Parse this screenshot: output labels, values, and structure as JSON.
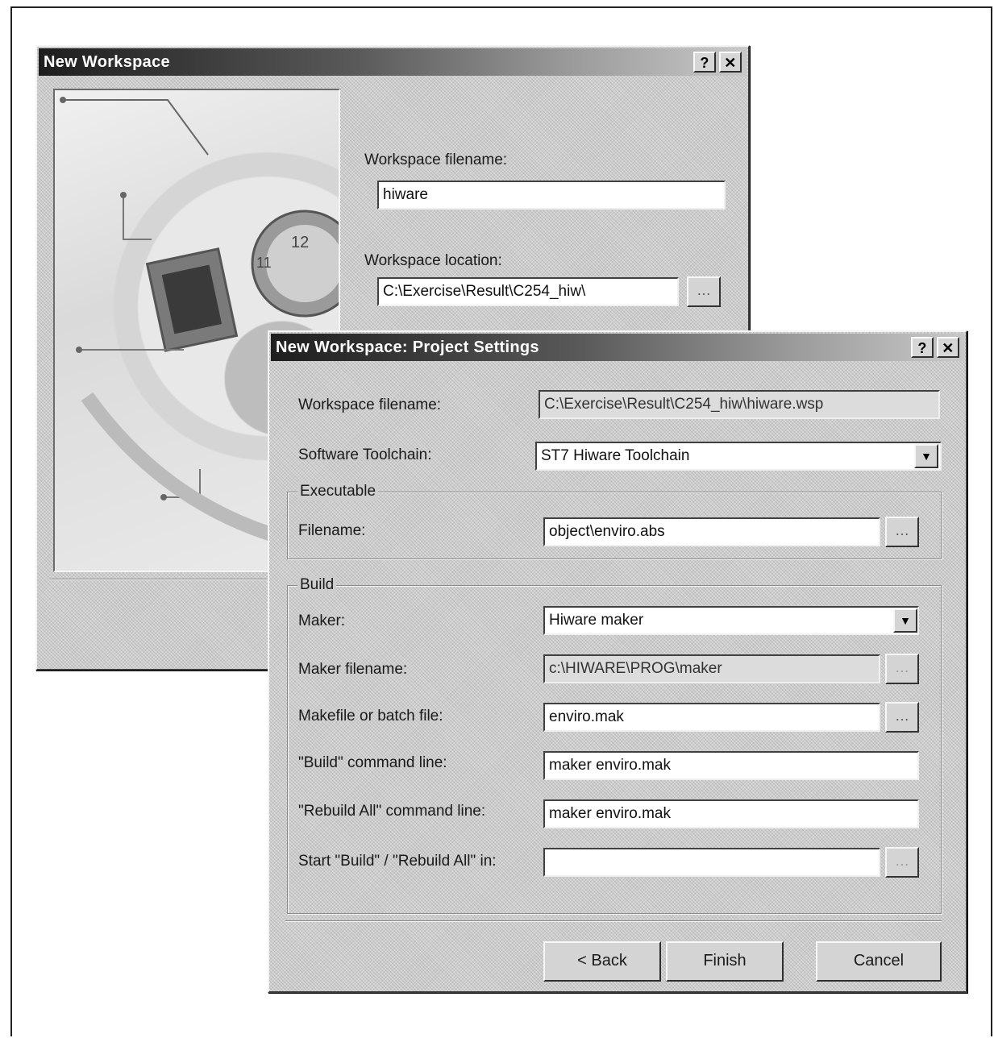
{
  "back_dialog": {
    "title": "New Workspace",
    "help_btn": "?",
    "close_btn": "✕",
    "filename_label": "Workspace filename:",
    "filename_value": "hiware",
    "location_label": "Workspace location:",
    "location_value": "C:\\Exercise\\Result\\C254_hiw\\",
    "browse_btn": "…"
  },
  "front_dialog": {
    "title": "New Workspace: Project Settings",
    "help_btn": "?",
    "close_btn": "✕",
    "workspace_filename_label": "Workspace filename:",
    "workspace_filename_value": "C:\\Exercise\\Result\\C254_hiw\\hiware.wsp",
    "toolchain_label": "Software Toolchain:",
    "toolchain_value": "ST7 Hiware Toolchain",
    "dropdown_arrow": "▼",
    "executable_group": "Executable",
    "exe_filename_label": "Filename:",
    "exe_filename_value": "object\\enviro.abs",
    "browse_btn": "…",
    "build_group": "Build",
    "maker_label": "Maker:",
    "maker_value": "Hiware maker",
    "maker_filename_label": "Maker filename:",
    "maker_filename_value": "c:\\HIWARE\\PROG\\maker",
    "makefile_label": "Makefile or batch file:",
    "makefile_value": "enviro.mak",
    "build_cmd_label": "\"Build\" command line:",
    "build_cmd_value": "maker enviro.mak",
    "rebuild_cmd_label": "\"Rebuild All\" command line:",
    "rebuild_cmd_value": "maker enviro.mak",
    "start_in_label": "Start \"Build\" / \"Rebuild All\" in:",
    "start_in_value": "",
    "back_btn": "< Back",
    "finish_btn": "Finish",
    "cancel_btn": "Cancel"
  }
}
